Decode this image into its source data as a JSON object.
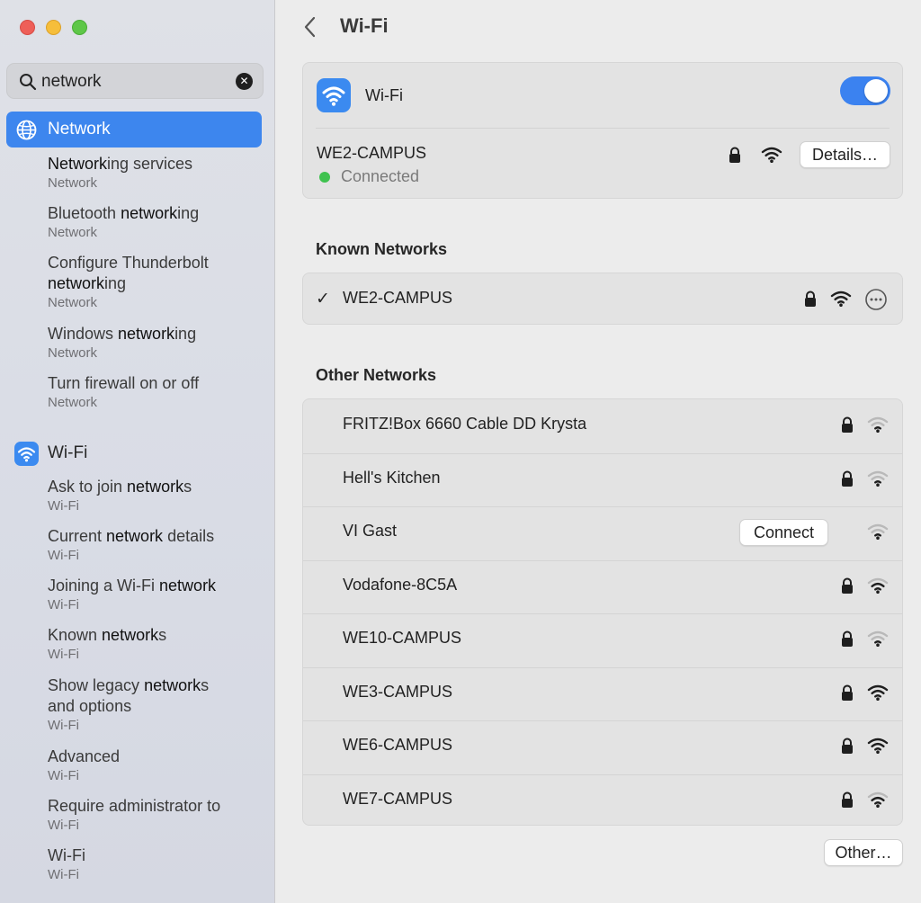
{
  "sidebar": {
    "search": {
      "value": "network",
      "placeholder": "Search"
    },
    "categories": [
      {
        "label": "Network",
        "icon": "globe-icon",
        "selected": true
      },
      {
        "label": "Wi-Fi",
        "icon": "wifi-icon",
        "selected": false
      }
    ],
    "network_results": [
      {
        "pre": "",
        "match": "Network",
        "post": "ing services",
        "sub": "Network"
      },
      {
        "pre": "Bluetooth ",
        "match": "network",
        "post": "ing",
        "sub": "Network"
      },
      {
        "line1": "Configure Thunderbolt",
        "pre": "",
        "match": "network",
        "post": "ing",
        "sub": "Network"
      },
      {
        "pre": "Windows ",
        "match": "network",
        "post": "ing",
        "sub": "Network"
      },
      {
        "pre": "Turn firewall on or off",
        "match": "",
        "post": "",
        "sub": "Network"
      }
    ],
    "wifi_results": [
      {
        "pre": "Ask to join ",
        "match": "network",
        "post": "s",
        "sub": "Wi-Fi"
      },
      {
        "pre": "Current ",
        "match": "network",
        "post": " details",
        "sub": "Wi-Fi"
      },
      {
        "pre": "Joining a Wi-Fi ",
        "match": "network",
        "post": "",
        "sub": "Wi-Fi"
      },
      {
        "pre": "Known ",
        "match": "network",
        "post": "s",
        "sub": "Wi-Fi"
      },
      {
        "pre": "Show legacy ",
        "match": "network",
        "post": "s",
        "line2": "and options",
        "sub": "Wi-Fi"
      },
      {
        "pre": "Advanced",
        "match": "",
        "post": "",
        "sub": "Wi-Fi"
      },
      {
        "pre": "Require administrator to",
        "match": "",
        "post": "",
        "sub": "Wi-Fi"
      },
      {
        "pre": "Wi-Fi",
        "match": "",
        "post": "",
        "sub": "Wi-Fi"
      }
    ]
  },
  "main": {
    "title": "Wi-Fi",
    "wifi_card": {
      "label": "Wi-Fi",
      "toggle_on": true,
      "current_network": "WE2-CAMPUS",
      "status": "Connected",
      "status_color": "#3fc24f",
      "details_button": "Details…"
    },
    "known_header": "Known Networks",
    "known_networks": [
      {
        "name": "WE2-CAMPUS",
        "check": "✓",
        "locked": true,
        "signal": "strong"
      }
    ],
    "other_header": "Other Networks",
    "other_networks": [
      {
        "name": "FRITZ!Box 6660 Cable DD Krysta",
        "locked": true,
        "signal": "weak"
      },
      {
        "name": "Hell's Kitchen",
        "locked": true,
        "signal": "weak"
      },
      {
        "name": "VI Gast",
        "locked": false,
        "signal": "weak",
        "connect_button": "Connect"
      },
      {
        "name": "Vodafone-8C5A",
        "locked": true,
        "signal": "medium"
      },
      {
        "name": "WE10-CAMPUS",
        "locked": true,
        "signal": "weak"
      },
      {
        "name": "WE3-CAMPUS",
        "locked": true,
        "signal": "strong"
      },
      {
        "name": "WE6-CAMPUS",
        "locked": true,
        "signal": "strong"
      },
      {
        "name": "WE7-CAMPUS",
        "locked": true,
        "signal": "medium"
      }
    ],
    "other_button": "Other…"
  },
  "colors": {
    "accent": "#3d86ee",
    "toggle": "#3b82f0",
    "connected": "#3fc24f"
  }
}
